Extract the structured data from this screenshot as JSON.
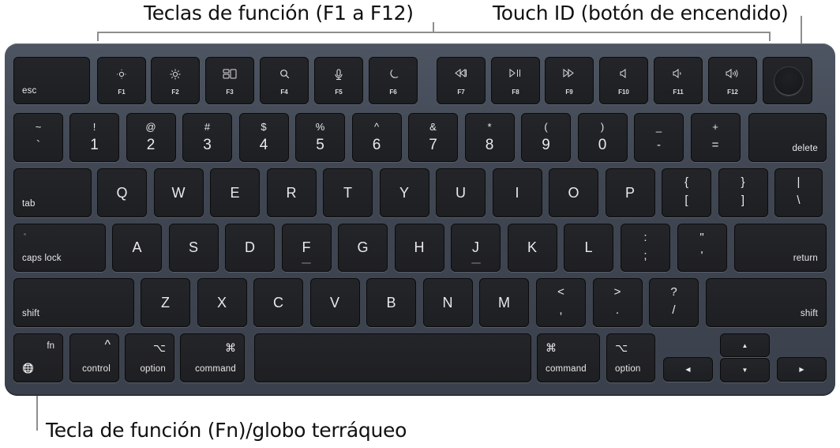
{
  "callouts": {
    "function_keys": "Teclas de función (F1 a F12)",
    "touch_id": "Touch ID (botón de encendido)",
    "fn_globe": "Tecla de función (Fn)/globo terráqueo"
  },
  "keyboard": {
    "row_fn": {
      "esc": "esc",
      "fkeys": [
        {
          "label": "F1",
          "icon": "brightness-down-icon"
        },
        {
          "label": "F2",
          "icon": "brightness-up-icon"
        },
        {
          "label": "F3",
          "icon": "mission-control-icon"
        },
        {
          "label": "F4",
          "icon": "spotlight-search-icon"
        },
        {
          "label": "F5",
          "icon": "dictation-microphone-icon"
        },
        {
          "label": "F6",
          "icon": "do-not-disturb-moon-icon"
        },
        {
          "label": "F7",
          "icon": "rewind-icon"
        },
        {
          "label": "F8",
          "icon": "play-pause-icon"
        },
        {
          "label": "F9",
          "icon": "fast-forward-icon"
        },
        {
          "label": "F10",
          "icon": "mute-icon"
        },
        {
          "label": "F11",
          "icon": "volume-down-icon"
        },
        {
          "label": "F12",
          "icon": "volume-up-icon"
        }
      ],
      "touch_id_icon": "touch-id-sensor-icon"
    },
    "row_numbers": {
      "keys": [
        {
          "top": "~",
          "bot": "`"
        },
        {
          "top": "!",
          "bot": "1"
        },
        {
          "top": "@",
          "bot": "2"
        },
        {
          "top": "#",
          "bot": "3"
        },
        {
          "top": "$",
          "bot": "4"
        },
        {
          "top": "%",
          "bot": "5"
        },
        {
          "top": "^",
          "bot": "6"
        },
        {
          "top": "&",
          "bot": "7"
        },
        {
          "top": "*",
          "bot": "8"
        },
        {
          "top": "(",
          "bot": "9"
        },
        {
          "top": ")",
          "bot": "0"
        },
        {
          "top": "_",
          "bot": "-"
        },
        {
          "top": "+",
          "bot": "="
        }
      ],
      "delete": "delete"
    },
    "row_qwerty": {
      "tab": "tab",
      "letters": [
        "Q",
        "W",
        "E",
        "R",
        "T",
        "Y",
        "U",
        "I",
        "O",
        "P"
      ],
      "sym": [
        {
          "top": "{",
          "bot": "["
        },
        {
          "top": "}",
          "bot": "]"
        },
        {
          "top": "|",
          "bot": "\\"
        }
      ]
    },
    "row_home": {
      "caps": "caps lock",
      "letters": [
        "A",
        "S",
        "D",
        "F",
        "G",
        "H",
        "J",
        "K",
        "L"
      ],
      "sym": [
        {
          "top": ":",
          "bot": ";"
        },
        {
          "top": "\"",
          "bot": "'"
        }
      ],
      "return": "return"
    },
    "row_shift": {
      "shift_left": "shift",
      "letters": [
        "Z",
        "X",
        "C",
        "V",
        "B",
        "N",
        "M"
      ],
      "sym": [
        {
          "top": "<",
          "bot": ","
        },
        {
          "top": ">",
          "bot": "."
        },
        {
          "top": "?",
          "bot": "/"
        }
      ],
      "shift_right": "shift"
    },
    "row_bottom": {
      "fn": "fn",
      "globe_icon": "🌐",
      "control": "control",
      "control_symbol": "^",
      "option": "option",
      "option_symbol": "⌥",
      "command": "command",
      "command_symbol": "⌘",
      "arrows": {
        "up": "▲",
        "down": "▼",
        "left": "◀",
        "right": "▶"
      }
    }
  }
}
